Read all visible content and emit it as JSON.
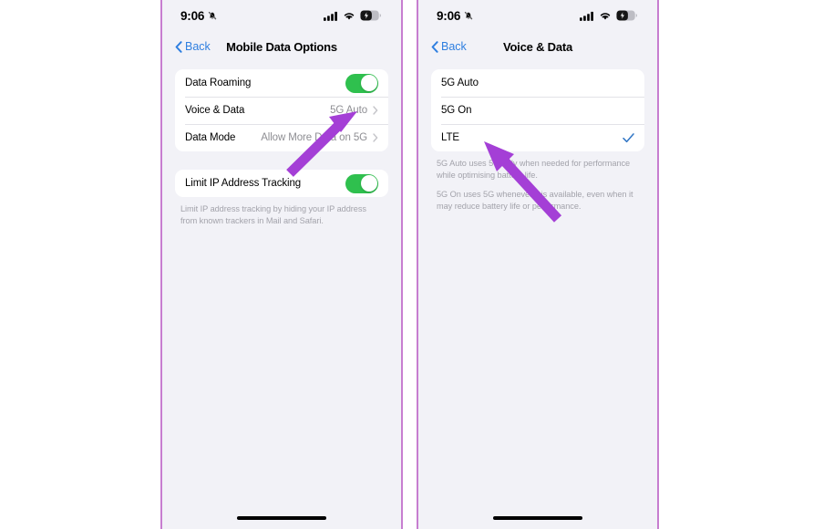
{
  "theme": {
    "accent_blue": "#2f7fe0",
    "toggle_green": "#2fc04e",
    "check_blue": "#3478c6",
    "frame_purple": "#c77ed0",
    "arrow_purple": "#a43fd6",
    "screen_bg": "#f2f2f7",
    "card_bg": "#ffffff",
    "secondary_text": "#8e8e93",
    "footer_text": "#a3a3ab"
  },
  "screens": [
    {
      "status_bar": {
        "time": "9:06",
        "silent_icon": "bell-slash-icon",
        "signal_icon": "cellular-signal-icon",
        "wifi_icon": "wifi-icon",
        "battery_icon": "battery-charging-icon"
      },
      "nav": {
        "back_label": "Back",
        "back_icon": "chevron-left-icon",
        "title": "Mobile Data Options"
      },
      "groups": [
        {
          "rows": [
            {
              "label": "Data Roaming",
              "control": "toggle",
              "toggle_on": true
            },
            {
              "label": "Voice & Data",
              "control": "disclosure",
              "value": "5G Auto"
            },
            {
              "label": "Data Mode",
              "control": "disclosure",
              "value": "Allow More Data on 5G"
            }
          ]
        },
        {
          "rows": [
            {
              "label": "Limit IP Address Tracking",
              "control": "toggle",
              "toggle_on": true
            }
          ],
          "footer": [
            "Limit IP address tracking by hiding your IP address from known trackers in Mail and Safari."
          ]
        }
      ]
    },
    {
      "status_bar": {
        "time": "9:06",
        "silent_icon": "bell-slash-icon",
        "signal_icon": "cellular-signal-icon",
        "wifi_icon": "wifi-icon",
        "battery_icon": "battery-charging-icon"
      },
      "nav": {
        "back_label": "Back",
        "back_icon": "chevron-left-icon",
        "title": "Voice & Data"
      },
      "groups": [
        {
          "rows": [
            {
              "label": "5G Auto",
              "control": "none",
              "selected": false
            },
            {
              "label": "5G On",
              "control": "none",
              "selected": false
            },
            {
              "label": "LTE",
              "control": "check",
              "selected": true
            }
          ],
          "footer": [
            "5G Auto uses 5G only when needed for performance while optimising battery life.",
            "5G On uses 5G whenever it is available, even when it may reduce battery life or performance."
          ]
        }
      ]
    }
  ],
  "annotations": [
    {
      "name": "arrow-to-voice-and-data-value",
      "points_at": "5G Auto"
    },
    {
      "name": "arrow-to-lte-option",
      "points_at": "LTE"
    }
  ]
}
